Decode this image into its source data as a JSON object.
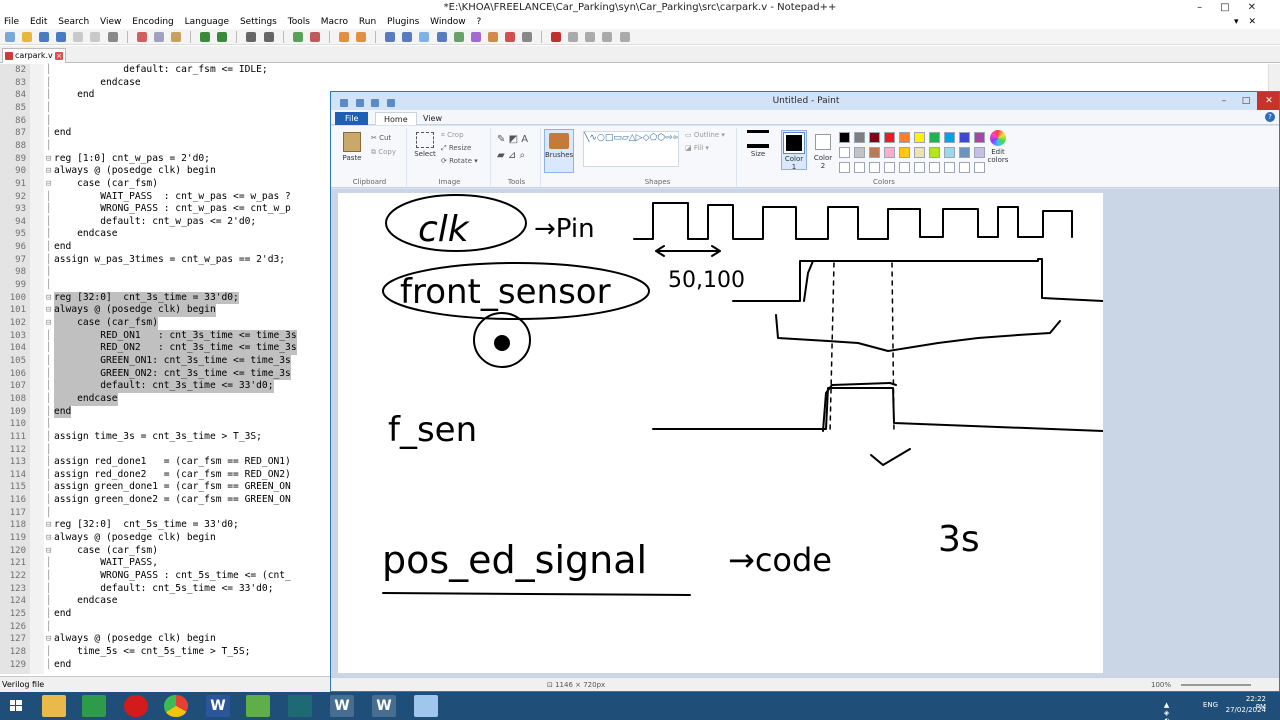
{
  "notepad": {
    "title": "*E:\\KHOA\\FREELANCE\\Car_Parking\\syn\\Car_Parking\\src\\carpark.v - Notepad++",
    "menu": [
      "File",
      "Edit",
      "Search",
      "View",
      "Encoding",
      "Language",
      "Settings",
      "Tools",
      "Macro",
      "Run",
      "Plugins",
      "Window",
      "?"
    ],
    "tab": "carpark.v",
    "status": "Verilog file",
    "lines": [
      {
        "n": "82",
        "t": "            default: car_fsm <= IDLE;"
      },
      {
        "n": "83",
        "t": "        endcase"
      },
      {
        "n": "84",
        "t": "    end"
      },
      {
        "n": "85",
        "t": ""
      },
      {
        "n": "86",
        "t": ""
      },
      {
        "n": "87",
        "t": "end"
      },
      {
        "n": "88",
        "t": ""
      },
      {
        "n": "89",
        "t": "reg [1:0] cnt_w_pas = 2'd0;"
      },
      {
        "n": "90",
        "t": "always @ (posedge clk) begin"
      },
      {
        "n": "91",
        "t": "    case (car_fsm)"
      },
      {
        "n": "92",
        "t": "        WAIT_PASS  : cnt_w_pas <= w_pas ?"
      },
      {
        "n": "93",
        "t": "        WRONG_PASS : cnt_w_pas <= cnt_w_p"
      },
      {
        "n": "94",
        "t": "        default: cnt_w_pas <= 2'd0;"
      },
      {
        "n": "95",
        "t": "    endcase"
      },
      {
        "n": "96",
        "t": "end"
      },
      {
        "n": "97",
        "t": "assign w_pas_3times = cnt_w_pas == 2'd3;"
      },
      {
        "n": "98",
        "t": ""
      },
      {
        "n": "99",
        "t": ""
      },
      {
        "n": "100",
        "t": "reg [32:0]  cnt_3s_time = 33'd0;"
      },
      {
        "n": "101",
        "t": "always @ (posedge clk) begin"
      },
      {
        "n": "102",
        "t": "    case (car_fsm)"
      },
      {
        "n": "103",
        "t": "        RED_ON1   : cnt_3s_time <= time_3s"
      },
      {
        "n": "104",
        "t": "        RED_ON2   : cnt_3s_time <= time_3s"
      },
      {
        "n": "105",
        "t": "        GREEN_ON1: cnt_3s_time <= time_3s"
      },
      {
        "n": "106",
        "t": "        GREEN_ON2: cnt_3s_time <= time_3s"
      },
      {
        "n": "107",
        "t": "        default: cnt_3s_time <= 33'd0;"
      },
      {
        "n": "108",
        "t": "    endcase"
      },
      {
        "n": "109",
        "t": "end"
      },
      {
        "n": "110",
        "t": ""
      },
      {
        "n": "111",
        "t": "assign time_3s = cnt_3s_time > T_3S;"
      },
      {
        "n": "112",
        "t": ""
      },
      {
        "n": "113",
        "t": "assign red_done1   = (car_fsm == RED_ON1)"
      },
      {
        "n": "114",
        "t": "assign red_done2   = (car_fsm == RED_ON2)"
      },
      {
        "n": "115",
        "t": "assign green_done1 = (car_fsm == GREEN_ON"
      },
      {
        "n": "116",
        "t": "assign green_done2 = (car_fsm == GREEN_ON"
      },
      {
        "n": "117",
        "t": ""
      },
      {
        "n": "118",
        "t": "reg [32:0]  cnt_5s_time = 33'd0;"
      },
      {
        "n": "119",
        "t": "always @ (posedge clk) begin"
      },
      {
        "n": "120",
        "t": "    case (car_fsm)"
      },
      {
        "n": "121",
        "t": "        WAIT_PASS,"
      },
      {
        "n": "122",
        "t": "        WRONG_PASS : cnt_5s_time <= (cnt_"
      },
      {
        "n": "123",
        "t": "        default: cnt_5s_time <= 33'd0;"
      },
      {
        "n": "124",
        "t": "    endcase"
      },
      {
        "n": "125",
        "t": "end"
      },
      {
        "n": "126",
        "t": ""
      },
      {
        "n": "127",
        "t": "always @ (posedge clk) begin"
      },
      {
        "n": "128",
        "t": "    time_5s <= cnt_5s_time > T_5S;"
      },
      {
        "n": "129",
        "t": "end"
      }
    ],
    "selected_lines": [
      "100",
      "101",
      "102",
      "103",
      "104",
      "105",
      "106",
      "107",
      "108",
      "109"
    ]
  },
  "paint": {
    "title": "Untitled - Paint",
    "tabs": {
      "file": "File",
      "home": "Home",
      "view": "View"
    },
    "clipboard": {
      "paste": "Paste",
      "cut": "Cut",
      "copy": "Copy",
      "label": "Clipboard"
    },
    "image": {
      "select": "Select",
      "crop": "Crop",
      "resize": "Resize",
      "rotate": "Rotate",
      "label": "Image"
    },
    "tools": {
      "label": "Tools"
    },
    "brushes": "Brushes",
    "shapes": {
      "outline": "Outline",
      "fill": "Fill",
      "label": "Shapes"
    },
    "size": "Size",
    "color1": "Color 1",
    "color2": "Color 2",
    "colors_label": "Colors",
    "edit_colors": "Edit colors",
    "palette_row1": [
      "#000000",
      "#7f7f7f",
      "#880015",
      "#ed1c24",
      "#ff7f27",
      "#fff200",
      "#22b14c",
      "#00a2e8",
      "#3f48cc",
      "#a349a4"
    ],
    "palette_row2": [
      "#ffffff",
      "#c3c3c3",
      "#b97a57",
      "#ffaec9",
      "#ffc90e",
      "#efe4b0",
      "#b5e61d",
      "#99d9ea",
      "#7092be",
      "#c8bfe7"
    ],
    "status_size": "1146 × 720px",
    "status_zoom": "100%",
    "handwriting": {
      "clk": "clk",
      "pin": "→Pin",
      "front_sensor": "front_sensor",
      "count": "50,100",
      "f_sen": "f_sen",
      "pos_ed_signal": "pos_ed_signal",
      "code": "→code",
      "three_s": "3s"
    }
  },
  "taskbar": {
    "lang": "ENG",
    "time": "22:22 PM",
    "date": "27/02/2024"
  }
}
